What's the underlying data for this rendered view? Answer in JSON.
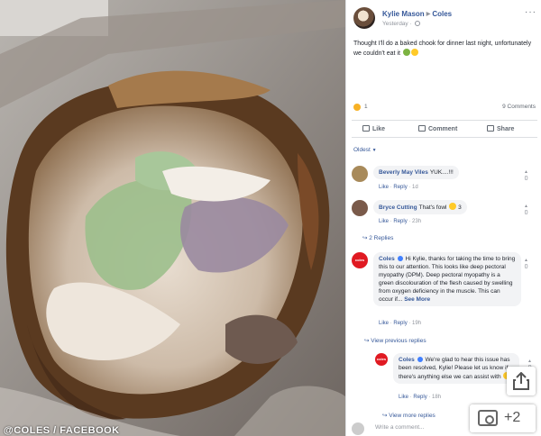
{
  "photo": {
    "credit": "@COLES / FACEBOOK"
  },
  "post": {
    "author": "Kylie Mason",
    "target": "Coles",
    "time": "Yesterday",
    "body": "Thought I'll do a baked chook for dinner last night, unfortunately we couldn't eat it",
    "reaction_count": "1",
    "comment_count": "9 Comments",
    "actions": {
      "like": "Like",
      "comment": "Comment",
      "share": "Share"
    },
    "sort_label": "Oldest"
  },
  "comments": [
    {
      "name": "Beverly May Viles",
      "text": "YUK....!!!",
      "like": "Like",
      "reply": "Reply",
      "time": "1d",
      "votes": "0"
    },
    {
      "name": "Bryce Cutting",
      "text": "That's fowl",
      "reaction_count": "3",
      "like": "Like",
      "reply": "Reply",
      "time": "23h",
      "votes": "0",
      "replies_link": "2 Replies"
    },
    {
      "name": "Coles",
      "text": "Hi Kylie, thanks for taking the time to bring this to our attention. This looks like deep pectoral myopathy (DPM). Deep pectoral myopathy is a green discolouration of the flesh caused by swelling from oxygen deficiency in the muscle. This can occur if...",
      "see_more": "See More",
      "like": "Like",
      "reply": "Reply",
      "time": "19h",
      "votes": "0",
      "replies_link": "View previous replies",
      "avatar_text": "coles"
    },
    {
      "name": "Coles",
      "text": "We're glad to hear this issue has been resolved, Kylie! Please let us know if there's anything else we can assist with",
      "like": "Like",
      "reply": "Reply",
      "time": "18h",
      "votes": "0",
      "replies_link": "View more replies",
      "avatar_text": "coles"
    }
  ],
  "composer": {
    "placeholder": "Write a comment..."
  },
  "overlay": {
    "gallery_count": "+2"
  },
  "colors": {
    "facebook_link": "#365899",
    "coles_red": "#e01a22"
  }
}
